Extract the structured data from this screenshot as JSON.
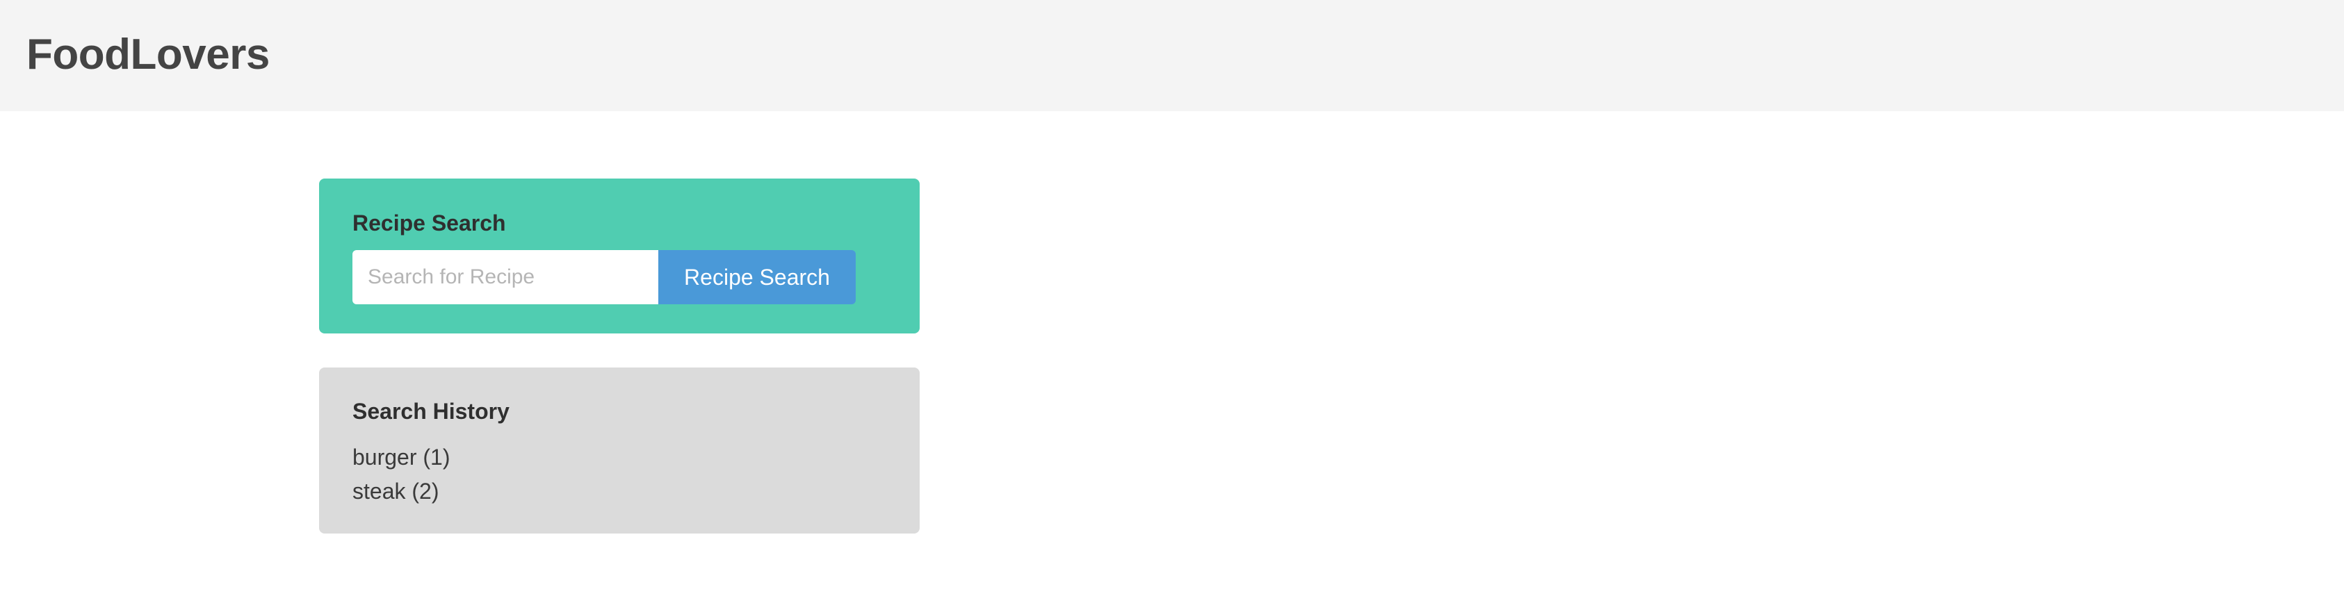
{
  "header": {
    "brand": "FoodLovers"
  },
  "search": {
    "title": "Recipe Search",
    "placeholder": "Search for Recipe",
    "value": "",
    "button_label": "Recipe Search"
  },
  "history": {
    "title": "Search History",
    "items": [
      {
        "label": "burger (1)"
      },
      {
        "label": "steak (2)"
      }
    ]
  },
  "colors": {
    "header_bg": "#f4f4f4",
    "search_card_bg": "#50cdb1",
    "history_card_bg": "#dbdbdb",
    "button_bg": "#4a99d8"
  }
}
